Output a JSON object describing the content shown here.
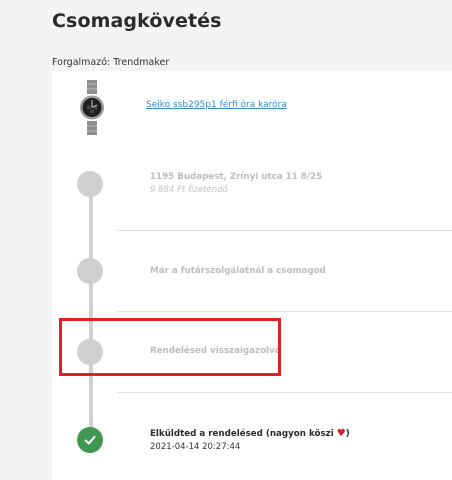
{
  "page": {
    "title": "Csomagkövetés",
    "seller": "Forgalmazó: Trendmaker"
  },
  "product": {
    "name": "Seiko ssb295p1 férfi óra karóra",
    "image_icon": "wristwatch-image"
  },
  "steps": [
    {
      "title": "1195 Budapest, Zrínyi utca 11 8/25",
      "subtitle": "9 884 Ft fizetendő",
      "status": "pending"
    },
    {
      "title": "Már a futárszolgálatnál a csomagod",
      "status": "pending"
    },
    {
      "title": "Rendelésed visszaigazolva",
      "status": "pending"
    },
    {
      "title": "Elküldted a rendelésed (nagyon köszi",
      "title_suffix": ")",
      "heart": "♥",
      "date": "2021-04-14 20:27:44",
      "status": "done"
    }
  ],
  "colors": {
    "done": "#3f9752",
    "pending": "#cfcfcf",
    "link": "#3a8bcb",
    "highlight": "#e01f26"
  }
}
